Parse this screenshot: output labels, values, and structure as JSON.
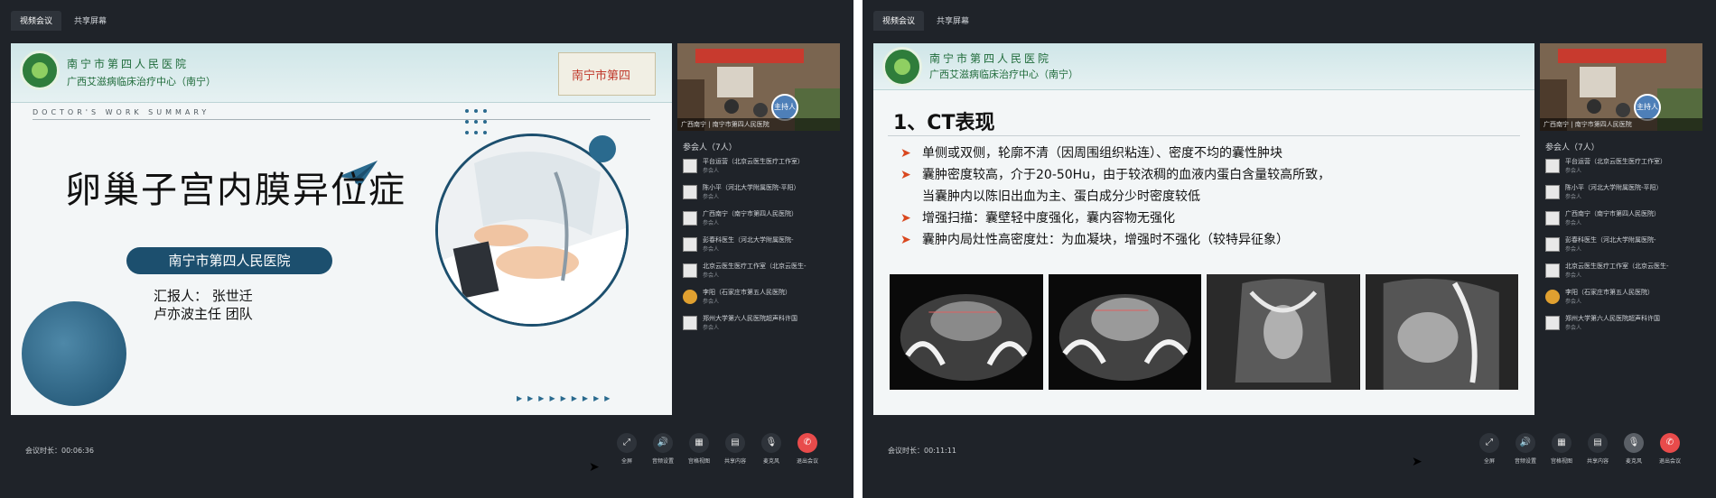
{
  "screens": [
    {
      "tabs": [
        "视频会议",
        "共享屏幕"
      ],
      "slide": {
        "type": "title",
        "hospital_name": "南宁市第四人民医院",
        "hospital_sub": "广西艾滋病临床治疗中心（南宁）",
        "stamp_text": "南宁市第四",
        "section_label": "DOCTOR'S WORK SUMMARY",
        "title": "卵巢子宫内膜异位症",
        "pill_text": "南宁市第四人民医院",
        "reporter_line1": "汇报人：  张世迁",
        "reporter_line2": "卢亦波主任  团队"
      },
      "video": {
        "caption": "广西南宁 | 南宁市第四人民医院",
        "badge": "主持人"
      },
      "participants": {
        "header": "参会人（7人）",
        "items": [
          {
            "name": "平台运营（北京云医生医疗工作室）",
            "role": "参会人"
          },
          {
            "name": "陈小平（河北大学附属医院-平阳）",
            "role": "参会人"
          },
          {
            "name": "广西南宁（南宁市第四人民医院）",
            "role": "参会人"
          },
          {
            "name": "彭春科医生（河北大学附属医院-",
            "role": "参会人"
          },
          {
            "name": "北京云医生医疗工作室（北京云医生-",
            "role": "参会人"
          },
          {
            "name": "李阳（石家庄市第五人民医院）",
            "role": "参会人"
          },
          {
            "name": "郑州大学第六人民医院超声科许国",
            "role": "参会人"
          }
        ]
      },
      "duration": "会议时长：00:06:36",
      "controls": [
        {
          "label": "全屏",
          "icon": "fullscreen-icon",
          "glyph": "⤢"
        },
        {
          "label": "音频设置",
          "icon": "speaker-icon",
          "glyph": "🔊"
        },
        {
          "label": "宫格视图",
          "icon": "grid-icon",
          "glyph": "▦"
        },
        {
          "label": "共享内容",
          "icon": "share-doc-icon",
          "glyph": "▤"
        },
        {
          "label": "麦克风",
          "icon": "microphone-icon",
          "glyph": "🎙"
        },
        {
          "label": "退出会议",
          "icon": "hangup-icon",
          "glyph": "✆"
        }
      ]
    },
    {
      "tabs": [
        "视频会议",
        "共享屏幕"
      ],
      "slide": {
        "type": "ct",
        "hospital_name": "南宁市第四人民医院",
        "hospital_sub": "广西艾滋病临床治疗中心（南宁）",
        "title": "1、CT表现",
        "bullets": [
          {
            "text": "单侧或双侧，轮廓不清（因周围组织粘连）、密度不均的囊性肿块",
            "cont": false
          },
          {
            "text": "囊肿密度较高，介于20-50Hu，由于较浓稠的血液内蛋白含量较高所致，",
            "cont": false
          },
          {
            "text": "当囊肿内以陈旧出血为主、蛋白成分少时密度较低",
            "cont": true
          },
          {
            "text": "增强扫描：囊壁轻中度强化，囊内容物无强化",
            "cont": false
          },
          {
            "text": "囊肿内局灶性高密度灶：为血凝块，增强时不强化（较特异征象）",
            "cont": false
          }
        ]
      },
      "video": {
        "caption": "广西南宁 | 南宁市第四人民医院",
        "badge": "主持人"
      },
      "participants": {
        "header": "参会人（7人）",
        "items": [
          {
            "name": "平台运营（北京云医生医疗工作室）",
            "role": "参会人"
          },
          {
            "name": "陈小平（河北大学附属医院-平阳）",
            "role": "参会人"
          },
          {
            "name": "广西南宁（南宁市第四人民医院）",
            "role": "参会人"
          },
          {
            "name": "彭春科医生（河北大学附属医院-",
            "role": "参会人"
          },
          {
            "name": "北京云医生医疗工作室（北京云医生-",
            "role": "参会人"
          },
          {
            "name": "李阳（石家庄市第五人民医院）",
            "role": "参会人"
          },
          {
            "name": "郑州大学第六人民医院超声科许国",
            "role": "参会人"
          }
        ]
      },
      "duration": "会议时长：00:11:11",
      "controls": [
        {
          "label": "全屏",
          "icon": "fullscreen-icon",
          "glyph": "⤢"
        },
        {
          "label": "音频设置",
          "icon": "speaker-icon",
          "glyph": "🔊"
        },
        {
          "label": "宫格视图",
          "icon": "grid-icon",
          "glyph": "▦"
        },
        {
          "label": "共享内容",
          "icon": "share-doc-icon",
          "glyph": "▤"
        },
        {
          "label": "麦克风",
          "icon": "microphone-off-icon",
          "glyph": "🎙"
        },
        {
          "label": "退出会议",
          "icon": "hangup-icon",
          "glyph": "✆"
        }
      ]
    }
  ]
}
